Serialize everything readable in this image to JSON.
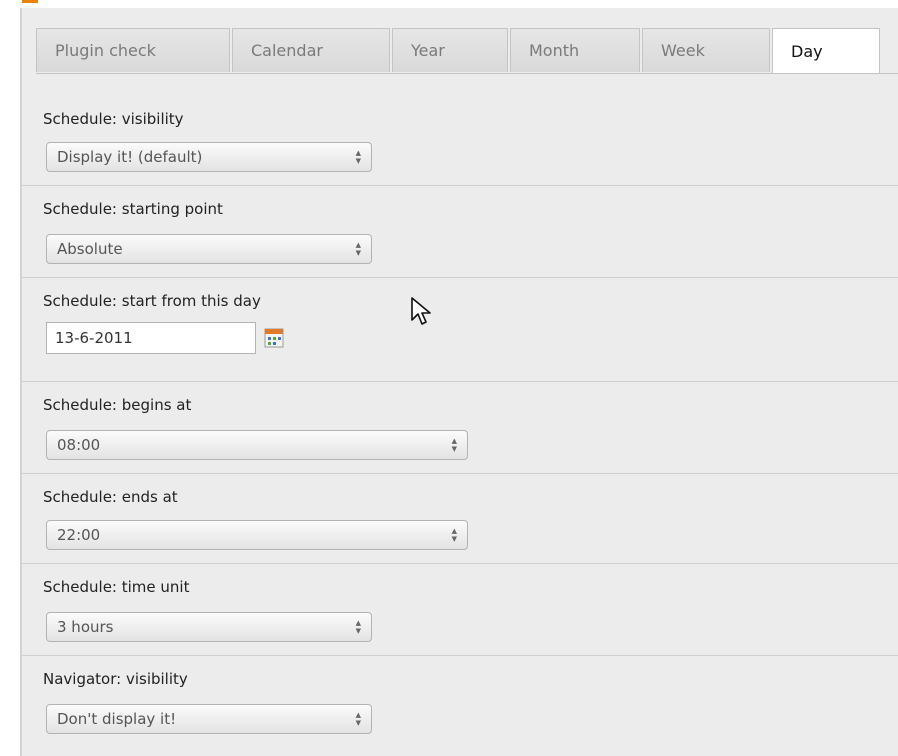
{
  "tabs": [
    {
      "label": "Plugin check",
      "active": false
    },
    {
      "label": "Calendar",
      "active": false
    },
    {
      "label": "Year",
      "active": false
    },
    {
      "label": "Month",
      "active": false
    },
    {
      "label": "Week",
      "active": false
    },
    {
      "label": "Day",
      "active": true
    }
  ],
  "fields": {
    "visibility": {
      "label": "Schedule: visibility",
      "value": "Display it! (default)"
    },
    "starting_point": {
      "label": "Schedule: starting point",
      "value": "Absolute"
    },
    "start_day": {
      "label": "Schedule: start from this day",
      "value": "13-6-2011"
    },
    "begins_at": {
      "label": "Schedule: begins at",
      "value": "08:00"
    },
    "ends_at": {
      "label": "Schedule: ends at",
      "value": "22:00"
    },
    "time_unit": {
      "label": "Schedule: time unit",
      "value": "3 hours"
    },
    "navigator_visibility": {
      "label": "Navigator: visibility",
      "value": "Don't display it!"
    }
  },
  "icons": {
    "select_arrows": "select-arrows-icon",
    "calendar": "calendar-icon",
    "cursor": "mouse-pointer-icon"
  },
  "colors": {
    "accent": "#e8820c",
    "panel": "#ececec"
  }
}
